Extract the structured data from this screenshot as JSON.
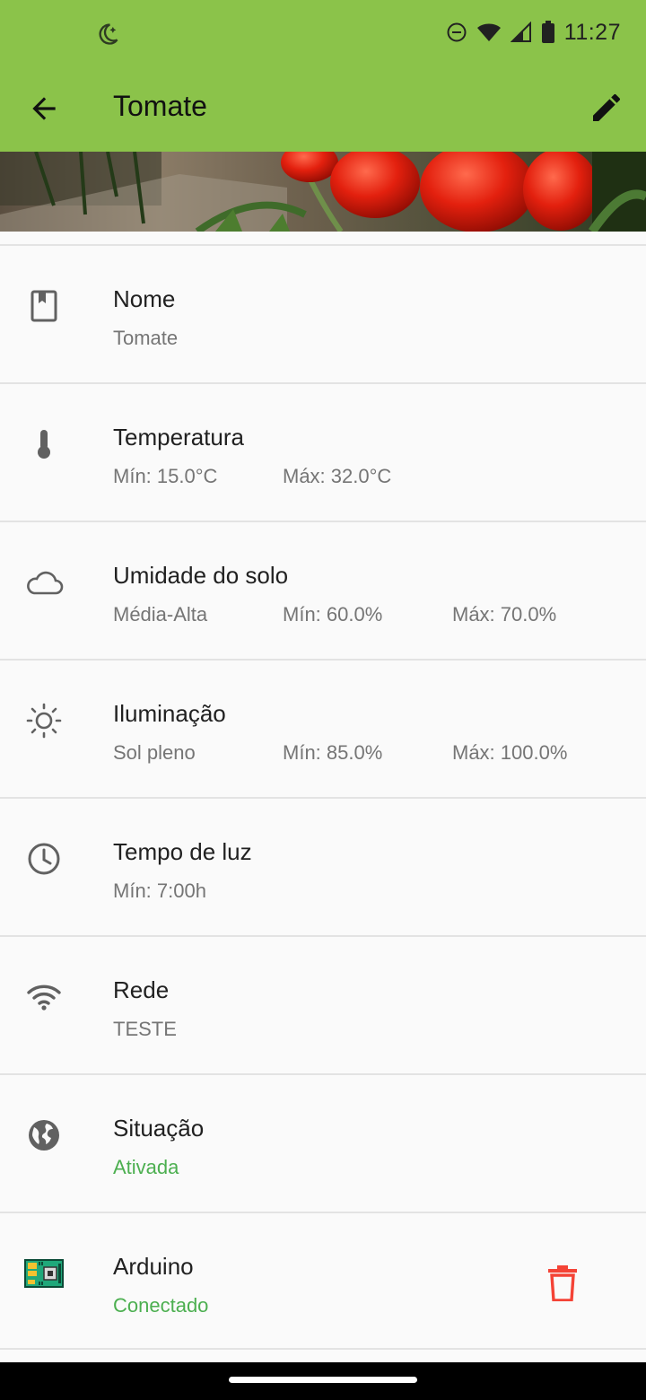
{
  "status": {
    "time": "11:27"
  },
  "app_bar": {
    "title": "Tomate"
  },
  "rows": [
    {
      "label": "Nome",
      "values": [
        "Tomate"
      ]
    },
    {
      "label": "Temperatura",
      "values": [
        "Mín: 15.0°C",
        "Máx: 32.0°C"
      ]
    },
    {
      "label": "Umidade do solo",
      "values": [
        "Média-Alta",
        "Mín: 60.0%",
        "Máx: 70.0%"
      ]
    },
    {
      "label": "Iluminação",
      "values": [
        "Sol pleno",
        "Mín: 85.0%",
        "Máx: 100.0%"
      ]
    },
    {
      "label": "Tempo de luz",
      "values": [
        "Mín: 7:00h"
      ]
    },
    {
      "label": "Rede",
      "values": [
        "TESTE"
      ]
    },
    {
      "label": "Situação",
      "values": [
        "Ativada"
      ]
    },
    {
      "label": "Arduino",
      "values": [
        "Conectado"
      ]
    }
  ],
  "icons": {
    "nome": "bookmark-icon",
    "temperatura": "thermometer-icon",
    "umidade": "cloud-icon",
    "iluminacao": "sun-icon",
    "tempo": "clock-icon",
    "rede": "wifi-icon",
    "situacao": "globe-icon",
    "arduino": "arduino-board-icon",
    "delete": "trash-icon"
  },
  "colors": {
    "primary": "#8bc34a",
    "success": "#4caf50",
    "danger": "#f44336"
  }
}
